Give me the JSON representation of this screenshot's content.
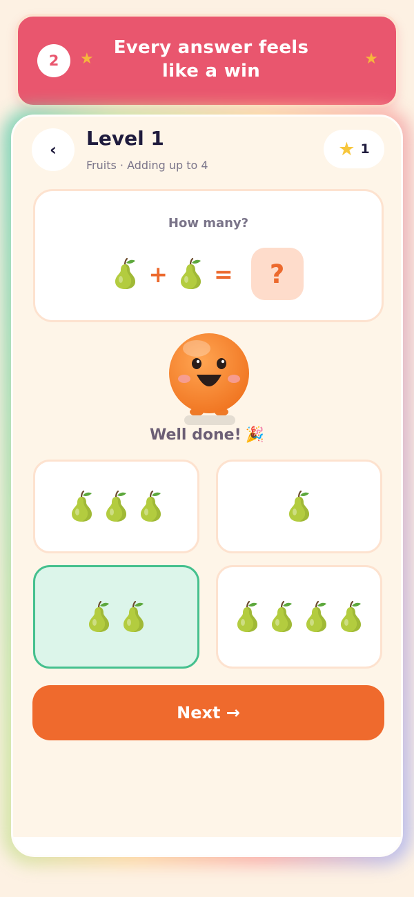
{
  "banner": {
    "step": "2",
    "title": "Every answer feels like a win"
  },
  "header": {
    "back_glyph": "‹",
    "title": "Level 1",
    "subtitle": "Fruits · Adding up to 4",
    "stars": "1"
  },
  "question": {
    "prompt": "How many?",
    "left_count": 1,
    "right_count": 1,
    "plus": "+",
    "equals": "=",
    "unknown": "?",
    "item_icon": "pear-icon"
  },
  "feedback": {
    "text": "Well done!",
    "emoji": "🎉"
  },
  "options": [
    {
      "count": 3,
      "selected": false
    },
    {
      "count": 1,
      "selected": false
    },
    {
      "count": 2,
      "selected": true
    },
    {
      "count": 4,
      "selected": false
    }
  ],
  "next_button": {
    "label": "Next →"
  },
  "colors": {
    "banner": "#e9566e",
    "accent": "#ef6a2d",
    "correct_fill": "#dcf5ea",
    "correct_border": "#45c08e",
    "background": "#fef5e8"
  }
}
